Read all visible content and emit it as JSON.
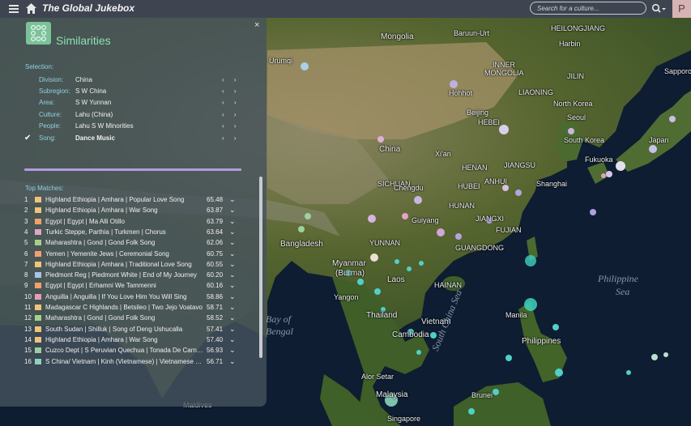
{
  "topbar": {
    "brand": "The Global Jukebox",
    "search_placeholder": "Search for a culture...",
    "avatar_letter": "P",
    "menu_icon": "hamburger-icon",
    "home_icon": "home-icon",
    "search_icon": "search-icon"
  },
  "panel": {
    "title": "Similarities",
    "close": "×",
    "selection_label": "Selection:",
    "selection": [
      {
        "key": "Division:",
        "value": "China"
      },
      {
        "key": "Subregion:",
        "value": "S W China"
      },
      {
        "key": "Area:",
        "value": "S W Yunnan"
      },
      {
        "key": "Culture:",
        "value": "Lahu (China)"
      },
      {
        "key": "People:",
        "value": "Lahu S W Minorities"
      },
      {
        "key": "Song:",
        "value": "Dance Music"
      }
    ],
    "nav_glyph": "‹ ›",
    "top_matches_label": "Top Matches:",
    "matches": [
      {
        "n": "1",
        "text": "Highland Ethiopia | Amhara | Popular Love Song",
        "score": "65.48",
        "color": "#f0c27a"
      },
      {
        "n": "2",
        "text": "Highland Ethiopia | Amhara | War Song",
        "score": "63.87",
        "color": "#f0c27a"
      },
      {
        "n": "3",
        "text": "Egypt | Egypt | Ma Alli Otillo",
        "score": "63.79",
        "color": "#f3a06a"
      },
      {
        "n": "4",
        "text": "Turkic Steppe, Parthia | Turkmen | Chorus",
        "score": "63.64",
        "color": "#e0a5c8"
      },
      {
        "n": "5",
        "text": "Maharashtra | Gond | Gond Folk Song",
        "score": "62.06",
        "color": "#a6d08a"
      },
      {
        "n": "6",
        "text": "Yemen | Yemenite Jews | Ceremonial Song",
        "score": "60.75",
        "color": "#f0a070"
      },
      {
        "n": "7",
        "text": "Highland Ethiopia | Amhara | Traditional Love Song",
        "score": "60.55",
        "color": "#f0c27a"
      },
      {
        "n": "8",
        "text": "Piedmont Reg | Piedmont White | End of My Journey",
        "score": "60.20",
        "color": "#a9c3e8"
      },
      {
        "n": "9",
        "text": "Egypt | Egypt | Erhamni We Tammenni",
        "score": "60.16",
        "color": "#f3a06a"
      },
      {
        "n": "10",
        "text": "Anguilla | Anguilla | If You Love Him You Will Sing",
        "score": "58.86",
        "color": "#e99ab6"
      },
      {
        "n": "11",
        "text": "Madagascar C Highlands | Betsileo | Two Jejo Voatavo",
        "score": "58.71",
        "color": "#f0c27a"
      },
      {
        "n": "12",
        "text": "Maharashtra | Gond | Gond Folk Song",
        "score": "58.52",
        "color": "#a6d08a"
      },
      {
        "n": "13",
        "text": "South Sudan | Shilluk | Song of Deng Ushucalla",
        "score": "57.41",
        "color": "#f0c27a"
      },
      {
        "n": "14",
        "text": "Highland Ethiopia | Amhara | War Song",
        "score": "57.40",
        "color": "#f0c27a"
      },
      {
        "n": "15",
        "text": "Cuzco Dept | S Peruvian Quechua | Tonada De Carnaval",
        "score": "56.93",
        "color": "#9ad0a0"
      },
      {
        "n": "16",
        "text": "S China/ Vietnam | Kinh (Vietnamese) | Vietnamese Song",
        "score": "56.71",
        "color": "#8fd0c0"
      }
    ],
    "dropdown_glyph": "⌄",
    "check_glyph": "✔"
  },
  "map": {
    "labels": [
      "Mongolia",
      "Baruun-Urt",
      "HEILONGJIANG",
      "Harbin",
      "Urumqi",
      "INNER",
      "MONGOLIA",
      "JILIN",
      "LIAONING",
      "Hohhot",
      "HEBEI",
      "North Korea",
      "Beijing",
      "Sapporo",
      "Japan",
      "South Korea",
      "Fukuoka",
      "Seoul",
      "China",
      "Xi'an",
      "HENAN",
      "JIANGSU",
      "SICHUAN",
      "HUBEI",
      "ANHUI",
      "Shanghai",
      "Chengdu",
      "HUNAN",
      "Guiyang",
      "JIANGXI",
      "FUJIAN",
      "YUNNAN",
      "GUANGDONG",
      "Bangladesh",
      "Myanmar",
      "(Burma)",
      "Laos",
      "HAINAN",
      "Yangon",
      "Thailand",
      "Vietnam",
      "Cambodia",
      "Manila",
      "Philippines",
      "Alor Setar",
      "Malaysia",
      "Singapore",
      "Brunei",
      "Maldives",
      "Bay of",
      "Bengal",
      "Philippine",
      "Sea",
      "South China Sea"
    ]
  }
}
